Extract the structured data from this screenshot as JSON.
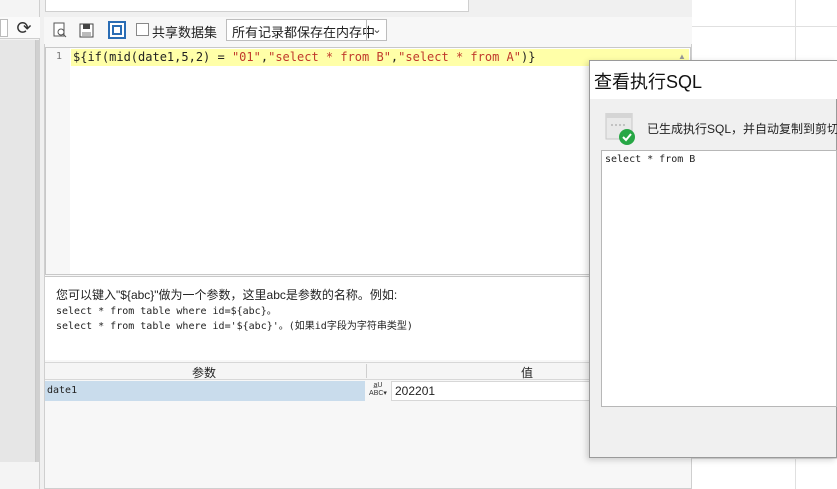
{
  "left": {
    "refresh_icon": "refresh-icon"
  },
  "toolbar": {
    "icons": [
      "preview-icon",
      "save-icon",
      "edit-sql-icon"
    ],
    "share_label": "共享数据集",
    "share_checked": false,
    "mode_value": "所有记录都保存在内存中"
  },
  "editor": {
    "line_number": "1",
    "code": {
      "p1": "${if(mid(date1,5,2) = ",
      "s1": "\"01\"",
      "p2": ",",
      "s2": "\"select * from B\"",
      "p3": ",",
      "s3": "\"select * from A\"",
      "p4": ")}"
    }
  },
  "hint": {
    "line1": "您可以键入\"${abc}\"做为一个参数，这里abc是参数的名称。例如:",
    "line2": "select * from table where id=${abc}。",
    "line3": "select * from table where id='${abc}'。(如果id字段为字符串类型)"
  },
  "params": {
    "header_param": "参数",
    "header_value": "值",
    "rows": [
      {
        "name": "date1",
        "type_icon": "abc-type-icon",
        "value": "202201"
      }
    ]
  },
  "dialog": {
    "title": "查看执行SQL",
    "message": "已生成执行SQL，并自动复制到剪切板",
    "sql": "select * from B"
  },
  "colors": {
    "highlight_line": "#ffffa8",
    "selected_row": "#c9dcec",
    "string": "#c0392b",
    "check": "#27a745"
  }
}
